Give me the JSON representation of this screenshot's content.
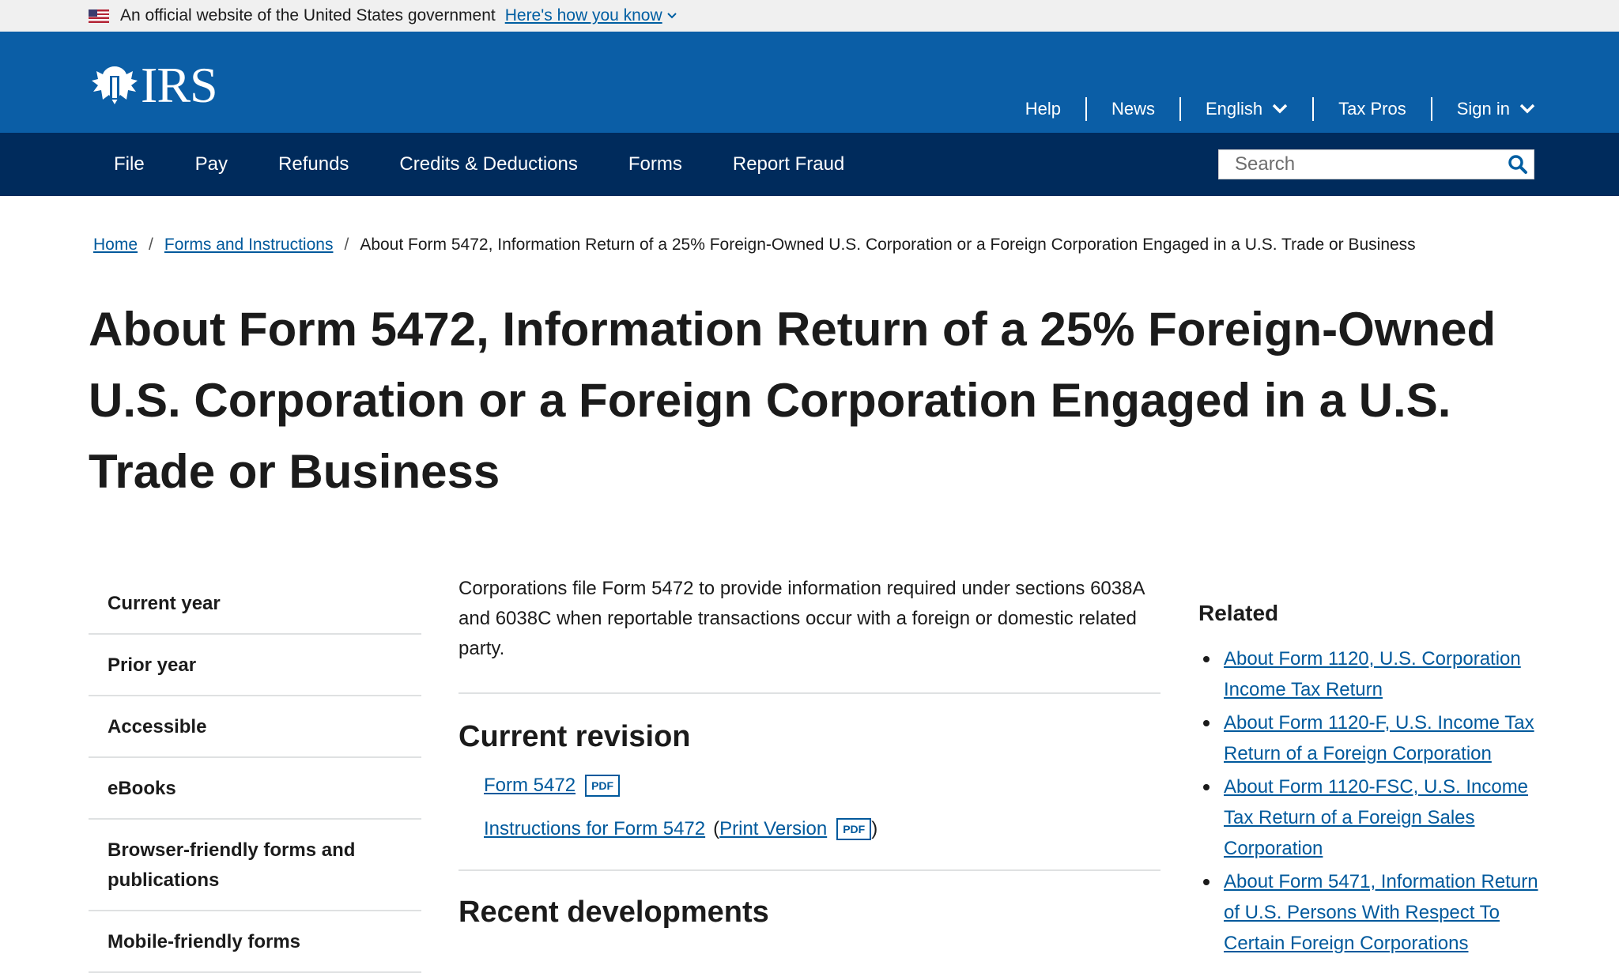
{
  "gov_banner": {
    "text": "An official website of the United States government",
    "link": "Here's how you know"
  },
  "header": {
    "logo_text": "IRS",
    "util_nav": [
      {
        "label": "Help"
      },
      {
        "label": "News"
      },
      {
        "label": "English"
      },
      {
        "label": "Tax Pros"
      },
      {
        "label": "Sign in"
      }
    ]
  },
  "main_nav": {
    "items": [
      "File",
      "Pay",
      "Refunds",
      "Credits & Deductions",
      "Forms",
      "Report Fraud"
    ],
    "search_placeholder": "Search"
  },
  "breadcrumb": {
    "home": "Home",
    "forms": "Forms and Instructions",
    "current": "About Form 5472, Information Return of a 25% Foreign-Owned U.S. Corporation or a Foreign Corporation Engaged in a U.S. Trade or Business"
  },
  "page_title": "About Form 5472, Information Return of a 25% Foreign-Owned U.S. Corporation or a Foreign Corporation Engaged in a U.S. Trade or Business",
  "sidebar": {
    "items": [
      "Current year",
      "Prior year",
      "Accessible",
      "eBooks",
      "Browser-friendly forms and publications",
      "Mobile-friendly forms"
    ]
  },
  "content": {
    "lead": "Corporations file Form 5472 to provide information required under sections 6038A and 6038C when reportable transactions occur with a foreign or domestic related party.",
    "current_revision_title": "Current revision",
    "form_link": "Form 5472",
    "pdf_label": "PDF",
    "instructions_link": "Instructions for Form 5472",
    "print_version": "Print Version",
    "open_paren": "(",
    "close_paren": ")",
    "recent_developments_title": "Recent developments"
  },
  "related": {
    "title": "Related",
    "links": [
      "About Form 1120, U.S. Corporation Income Tax Return",
      "About Form 1120-F, U.S. Income Tax Return of a Foreign Corporation",
      "About Form 1120-FSC, U.S. Income Tax Return of a Foreign Sales Corporation",
      "About Form 5471, Information Return of U.S. Persons With Respect To Certain Foreign Corporations"
    ]
  },
  "colors": {
    "header_blue": "#0b5ea6",
    "nav_dark": "#002b5c",
    "link": "#00599c"
  }
}
